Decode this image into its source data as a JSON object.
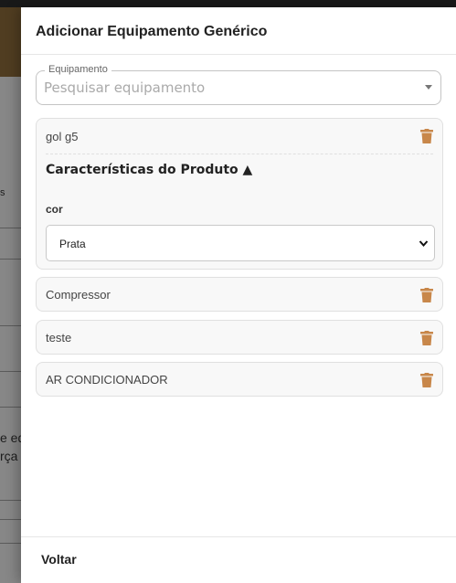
{
  "background_page": {
    "text_fragments": [
      "s",
      "e eq",
      "rça"
    ]
  },
  "drawer": {
    "title": "Adicionar Equipamento Genérico",
    "search": {
      "legend": "Equipamento",
      "placeholder": "Pesquisar equipamento"
    },
    "items": [
      {
        "name": "gol g5",
        "expanded": true,
        "characteristics_title": "Características do Produto ▲",
        "attribute_label": "cor",
        "attribute_value": "Prata"
      },
      {
        "name": "Compressor"
      },
      {
        "name": "teste"
      },
      {
        "name": "AR CONDICIONADOR"
      }
    ],
    "footer": {
      "back_label": "Voltar"
    }
  },
  "colors": {
    "trash_icon": "#c8874a",
    "banner": "#8a6a3a"
  }
}
